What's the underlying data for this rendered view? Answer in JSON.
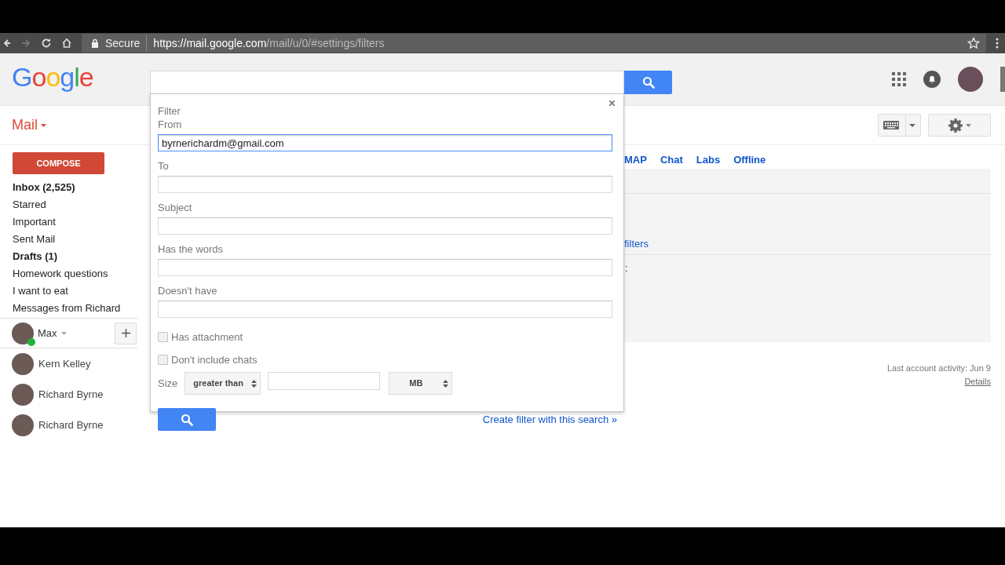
{
  "browser": {
    "secure_label": "Secure",
    "url_host": "https://mail.google.com",
    "url_path": "/mail/u/0/#settings/filters"
  },
  "header": {
    "logo": "Google"
  },
  "app_switcher": {
    "label": "Mail"
  },
  "compose": "COMPOSE",
  "folders": [
    {
      "label": "Inbox (2,525)",
      "bold": true
    },
    {
      "label": "Starred",
      "bold": false
    },
    {
      "label": "Important",
      "bold": false
    },
    {
      "label": "Sent Mail",
      "bold": false
    },
    {
      "label": "Drafts (1)",
      "bold": true
    },
    {
      "label": "Homework questions",
      "bold": false
    },
    {
      "label": "I want to eat",
      "bold": false
    },
    {
      "label": "Messages from Richard",
      "bold": false
    }
  ],
  "account": {
    "name": "Max",
    "online": true
  },
  "contacts": [
    {
      "name": "Kern Kelley"
    },
    {
      "name": "Richard Byrne"
    },
    {
      "name": "Richard Byrne"
    }
  ],
  "settings_tabs": [
    "MAP",
    "Chat",
    "Labs",
    "Offline"
  ],
  "settings_panel": {
    "link": "filters",
    "colon": ":"
  },
  "footer": {
    "activity": "Last account activity: Jun 9",
    "details": "Details"
  },
  "filter_dialog": {
    "title": "Filter",
    "fields": [
      {
        "label": "From",
        "value": "byrnerichardm@gmail.com",
        "focused": true
      },
      {
        "label": "To",
        "focused": false
      },
      {
        "label": "Subject",
        "focused": false
      },
      {
        "label": "Has the words",
        "focused": false
      },
      {
        "label": "Doesn't have",
        "focused": false
      }
    ],
    "checkboxes": [
      {
        "label": "Has attachment",
        "checked": false
      },
      {
        "label": "Don't include chats",
        "checked": false
      }
    ],
    "size_label": "Size",
    "size_operator": "greater than",
    "size_unit": "MB",
    "create_link": "Create filter with this search »"
  }
}
